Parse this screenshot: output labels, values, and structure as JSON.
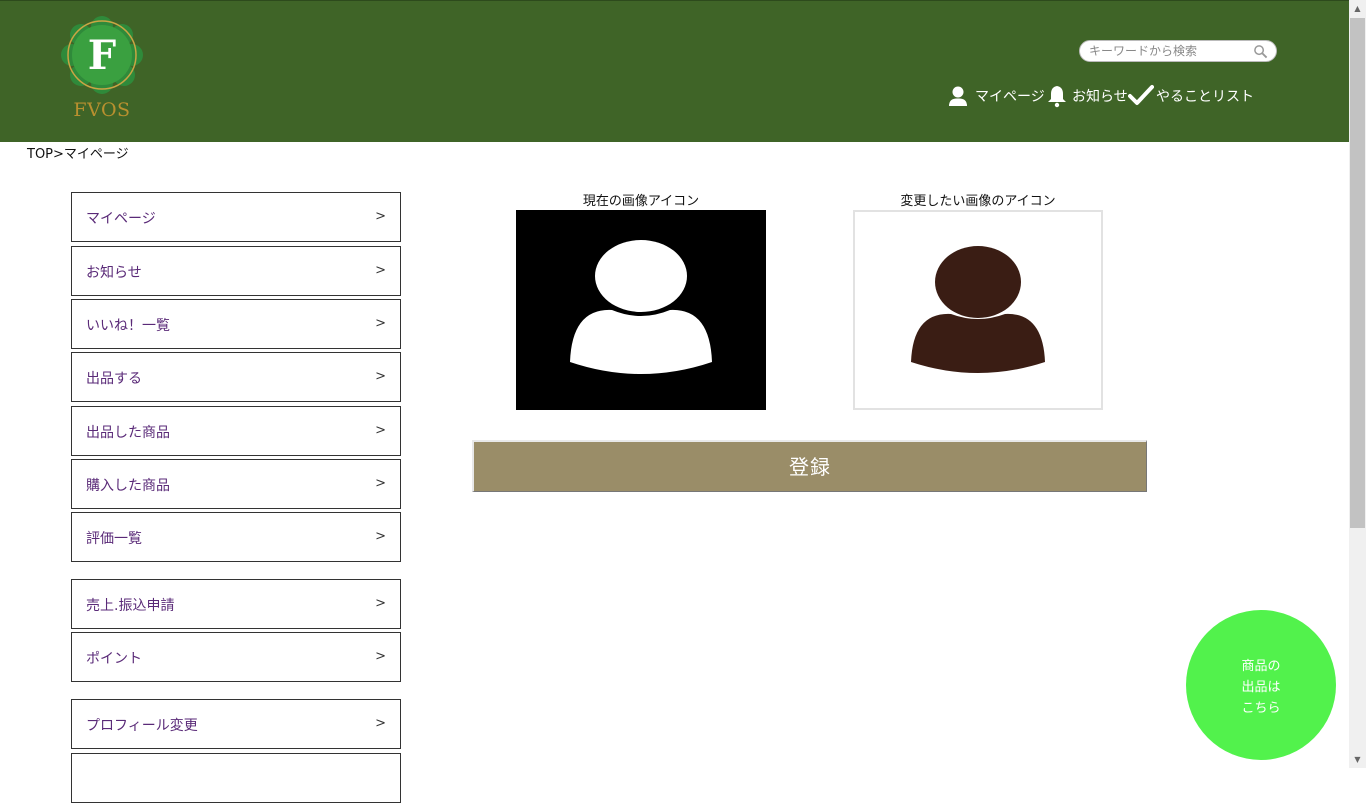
{
  "header": {
    "logo_text": "FVOS",
    "logo_letter": "F",
    "search": {
      "placeholder": "キーワードから検索",
      "value": ""
    },
    "nav": [
      {
        "label": "マイページ",
        "icon": "user-icon"
      },
      {
        "label": "お知らせ",
        "icon": "bell-icon"
      },
      {
        "label": "やることリスト",
        "icon": "check-icon"
      }
    ]
  },
  "breadcrumb": "TOP>マイページ",
  "sidebar": {
    "arrow": ">",
    "items": [
      {
        "label": "マイページ"
      },
      {
        "label": "お知らせ"
      },
      {
        "label": "いいね！一覧"
      },
      {
        "label": "出品する"
      },
      {
        "label": "出品した商品"
      },
      {
        "label": "購入した商品"
      },
      {
        "label": "評価一覧"
      },
      {
        "label": "売上.振込申請"
      },
      {
        "label": "ポイント"
      },
      {
        "label": "プロフィール変更"
      }
    ]
  },
  "main": {
    "current_caption": "現在の画像アイコン",
    "new_caption": "変更したい画像のアイコン",
    "register_label": "登録"
  },
  "fab": {
    "label": "商品の\n出品は\nこちら"
  },
  "colors": {
    "header_bg": "#3f6427",
    "logo_gold": "#b8902f",
    "sidebar_text": "#5a2a78",
    "register_bg": "#9a8d68",
    "fab_bg": "#52f24c",
    "new_avatar": "#3a1d14"
  }
}
